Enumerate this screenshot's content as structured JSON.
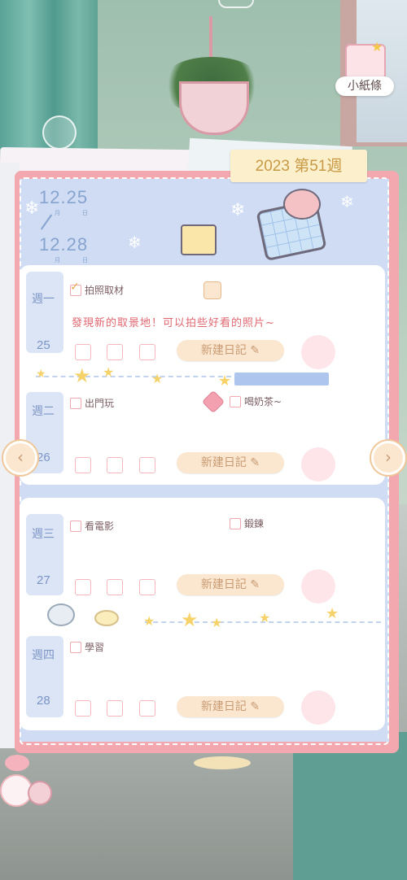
{
  "widget": {
    "note_label": "小紙條"
  },
  "planner": {
    "week_label": "2023 第51週",
    "date_start": "12.25",
    "date_end": "12.28",
    "month_unit": "月",
    "day_unit": "日"
  },
  "days": [
    {
      "name": "週一",
      "num": "25",
      "tasks": [
        {
          "label": "拍照取材",
          "checked": true
        }
      ],
      "highlight": "發現新的取景地！可以拍些好看的照片~",
      "new_entry": "新建日記"
    },
    {
      "name": "週二",
      "num": "26",
      "tasks": [
        {
          "label": "出門玩",
          "checked": false
        },
        {
          "label": "喝奶茶~",
          "checked": false
        }
      ],
      "new_entry": "新建日記"
    },
    {
      "name": "週三",
      "num": "27",
      "tasks": [
        {
          "label": "看電影",
          "checked": false
        },
        {
          "label": "鍛鍊",
          "checked": false
        }
      ],
      "new_entry": "新建日記"
    },
    {
      "name": "週四",
      "num": "28",
      "tasks": [
        {
          "label": "學習",
          "checked": false
        }
      ],
      "new_entry": "新建日記"
    }
  ],
  "nav": {
    "prev_icon": "chevron-left-icon",
    "next_icon": "chevron-right-icon",
    "prev_glyph": "‹",
    "next_glyph": "›"
  },
  "icons": {
    "edit": "✎",
    "check": "✓",
    "star": "★",
    "gift": "🎁"
  },
  "colors": {
    "planner_border": "#f3a7ae",
    "accent_pink": "#e06770",
    "week_gold": "#c99a45"
  }
}
